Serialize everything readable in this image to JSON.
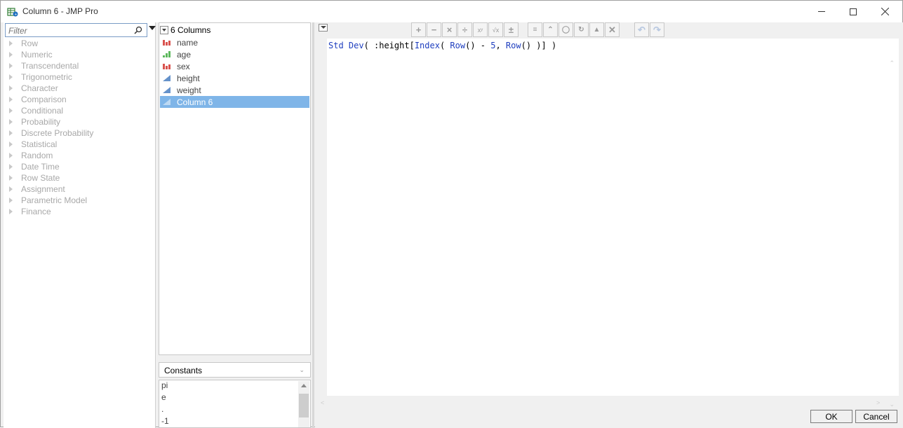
{
  "window": {
    "title": "Column 6 - JMP Pro"
  },
  "functions": {
    "filter_placeholder": "Filter",
    "categories": [
      "Row",
      "Numeric",
      "Transcendental",
      "Trigonometric",
      "Character",
      "Comparison",
      "Conditional",
      "Probability",
      "Discrete Probability",
      "Statistical",
      "Random",
      "Date Time",
      "Row State",
      "Assignment",
      "Parametric Model",
      "Finance"
    ]
  },
  "columns": {
    "header": "6 Columns",
    "items": [
      {
        "label": "name",
        "type": "nominal",
        "color": "#d9534f"
      },
      {
        "label": "age",
        "type": "ordinal",
        "color": "#5cb85c"
      },
      {
        "label": "sex",
        "type": "nominal",
        "color": "#d9534f"
      },
      {
        "label": "height",
        "type": "continuous",
        "color": "#4a7fc1"
      },
      {
        "label": "weight",
        "type": "continuous",
        "color": "#4a7fc1"
      },
      {
        "label": "Column 6",
        "type": "continuous",
        "color": "#4a7fc1",
        "selected": true
      }
    ]
  },
  "constants": {
    "header": "Constants",
    "items": [
      "pi",
      "e",
      ".",
      "-1"
    ]
  },
  "editor": {
    "formula_parts": [
      "Std Dev",
      "( :height[",
      "Index",
      "( ",
      "Row",
      "() - ",
      "5",
      ", ",
      "Row",
      "() )] )"
    ]
  },
  "buttons": {
    "ok": "OK",
    "cancel": "Cancel"
  }
}
